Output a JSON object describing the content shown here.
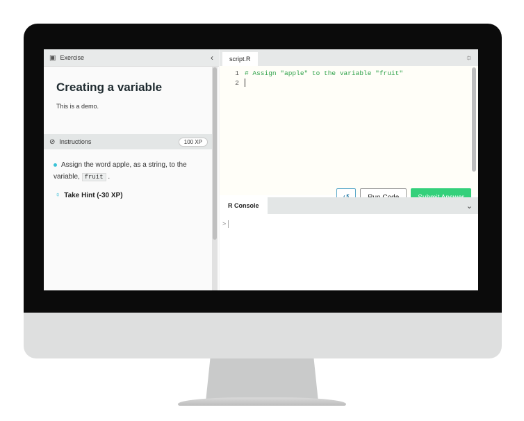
{
  "exercise_panel": {
    "header_label": "Exercise",
    "title": "Creating a variable",
    "description": "This is a demo.",
    "instructions_label": "Instructions",
    "xp_badge": "100 XP",
    "instruction_prefix": "Assign the word apple, as a string, to the variable,",
    "instruction_code": "fruit",
    "instruction_suffix": ".",
    "hint_label": "Take Hint (-30 XP)"
  },
  "editor": {
    "tab_label": "script.R",
    "lines": [
      {
        "number": "1",
        "text": "# Assign \"apple\" to the variable \"fruit\""
      },
      {
        "number": "2",
        "text": ""
      }
    ],
    "run_button_label": "Run Code",
    "submit_button_label": "Submit Answer"
  },
  "console": {
    "tab_label": "R Console",
    "prompt": ">"
  },
  "colors": {
    "submit": "#34d07b",
    "comment": "#2fa24a",
    "accent": "#3ac2d6"
  }
}
